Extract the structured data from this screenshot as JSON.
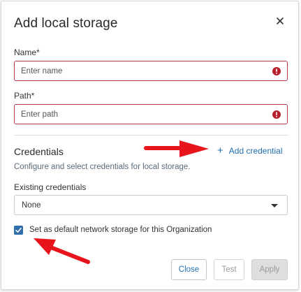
{
  "dialog": {
    "title": "Add local storage",
    "close_icon": "close-icon"
  },
  "name_field": {
    "label": "Name*",
    "placeholder": "Enter name",
    "value": "",
    "error_icon": "error-icon"
  },
  "path_field": {
    "label": "Path*",
    "placeholder": "Enter path",
    "value": "",
    "error_icon": "error-icon"
  },
  "credentials": {
    "title": "Credentials",
    "add_label": "Add credential",
    "add_icon": "plus-icon",
    "description": "Configure and select credentials for local storage.",
    "existing_label": "Existing credentials",
    "selected": "None"
  },
  "default_checkbox": {
    "checked": true,
    "label": "Set as default network storage for this Organization"
  },
  "buttons": {
    "close": "Close",
    "test": "Test",
    "apply": "Apply"
  },
  "annotations": {
    "arrow_color": "#e8141c"
  },
  "colors": {
    "accent": "#1f6fb2",
    "error": "#b23a48",
    "checkbox": "#2f6ea8"
  }
}
